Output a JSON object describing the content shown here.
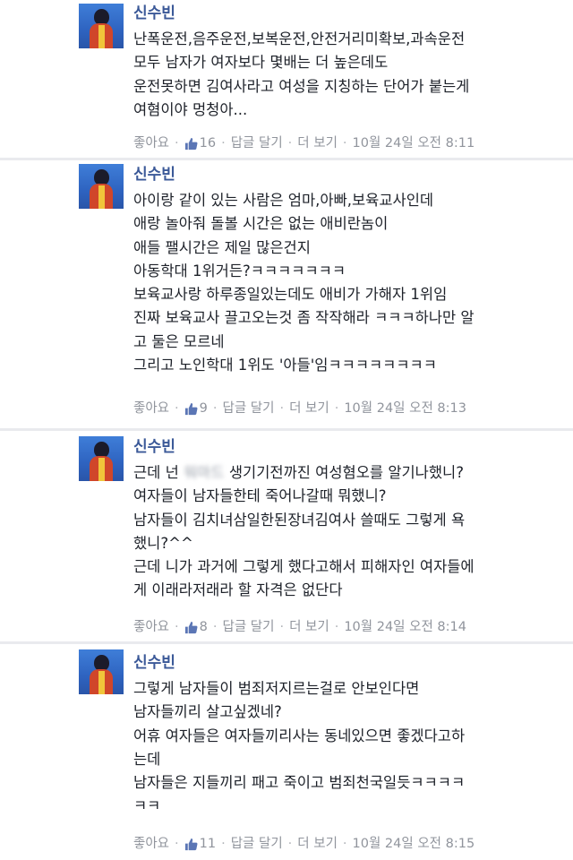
{
  "comments": [
    {
      "author": "신수빈",
      "lines": [
        "난폭운전,음주운전,보복운전,안전거리미확보,과속운전",
        "모두 남자가 여자보다 몇배는 더 높은데도",
        "운전못하면 김여사라고 여성을 지칭하는 단어가 붙는게",
        "여혐이야 멍청아..."
      ],
      "like_label": "좋아요",
      "like_count": "16",
      "reply_label": "답글 달기",
      "more_label": "더 보기",
      "timestamp": "10월 24일 오전 8:11"
    },
    {
      "author": "신수빈",
      "lines": [
        "아이랑 같이 있는 사람은 엄마,아빠,보육교사인데",
        "애랑 놀아줘 돌볼 시간은 없는 애비란놈이",
        "애들 팰시간은 제일 많은건지",
        "아동학대 1위거든?ㅋㅋㅋㅋㅋㅋㅋ",
        "보육교사랑 하루종일있는데도 애비가 가해자 1위임",
        "진짜 보육교사 끌고오는것 좀 작작해라 ㅋㅋㅋ하나만 알",
        "고 둘은 모르네",
        "그리고 노인학대 1위도 '아들'임ㅋㅋㅋㅋㅋㅋㅋㅋ"
      ],
      "like_label": "좋아요",
      "like_count": "9",
      "reply_label": "답글 달기",
      "more_label": "더 보기",
      "timestamp": "10월 24일 오전 8:13"
    },
    {
      "author": "신수빈",
      "line1_before": "근데 넌",
      "line1_redacted": "워마드",
      "line1_after": "생기기전까진 여성혐오를 알기나했니?",
      "lines": [
        "여자들이 남자들한테 죽어나갈때 뭐했니?",
        "남자들이 김치녀삼일한된장녀김여사 쓸때도 그렇게 욕",
        "했니?^^",
        "근데 니가 과거에 그렇게 했다고해서 피해자인 여자들에",
        "게 이래라저래라 할 자격은 없단다"
      ],
      "like_label": "좋아요",
      "like_count": "8",
      "reply_label": "답글 달기",
      "more_label": "더 보기",
      "timestamp": "10월 24일 오전 8:14"
    },
    {
      "author": "신수빈",
      "lines": [
        "그렇게 남자들이 범죄저지르는걸로 안보인다면",
        "남자들끼리 살고싶겠네?",
        "어휴 여자들은 여자들끼리사는 동네있으면 좋겠다고하",
        "는데",
        "남자들은 지들끼리 패고 죽이고 범죄천국일듯ㅋㅋㅋㅋ",
        "ㅋㅋ"
      ],
      "like_label": "좋아요",
      "like_count": "11",
      "reply_label": "답글 달기",
      "more_label": "더 보기",
      "timestamp": "10월 24일 오전 8:15"
    }
  ]
}
